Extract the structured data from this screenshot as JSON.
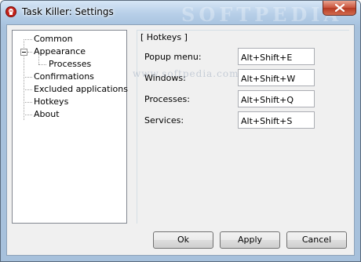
{
  "window": {
    "title": "Task Killer: Settings",
    "watermark": "SOFTPEDIA",
    "pane_watermark": "www.softpedia.com"
  },
  "tree": {
    "items": [
      {
        "label": "Common"
      },
      {
        "label": "Appearance"
      },
      {
        "label": "Processes"
      },
      {
        "label": "Confirmations"
      },
      {
        "label": "Excluded applications"
      },
      {
        "label": "Hotkeys"
      },
      {
        "label": "About"
      }
    ]
  },
  "hotkeys": {
    "group_title": "[ Hotkeys ]",
    "rows": [
      {
        "label": "Popup menu:",
        "value": "Alt+Shift+E"
      },
      {
        "label": "Windows:",
        "value": "Alt+Shift+W"
      },
      {
        "label": "Processes:",
        "value": "Alt+Shift+Q"
      },
      {
        "label": "Services:",
        "value": "Alt+Shift+S"
      }
    ]
  },
  "buttons": {
    "ok": "Ok",
    "apply": "Apply",
    "cancel": "Cancel"
  },
  "colors": {
    "title_bar": "#b7cfe8",
    "close_button": "#c9533c",
    "client_background": "#f0f0f0"
  }
}
